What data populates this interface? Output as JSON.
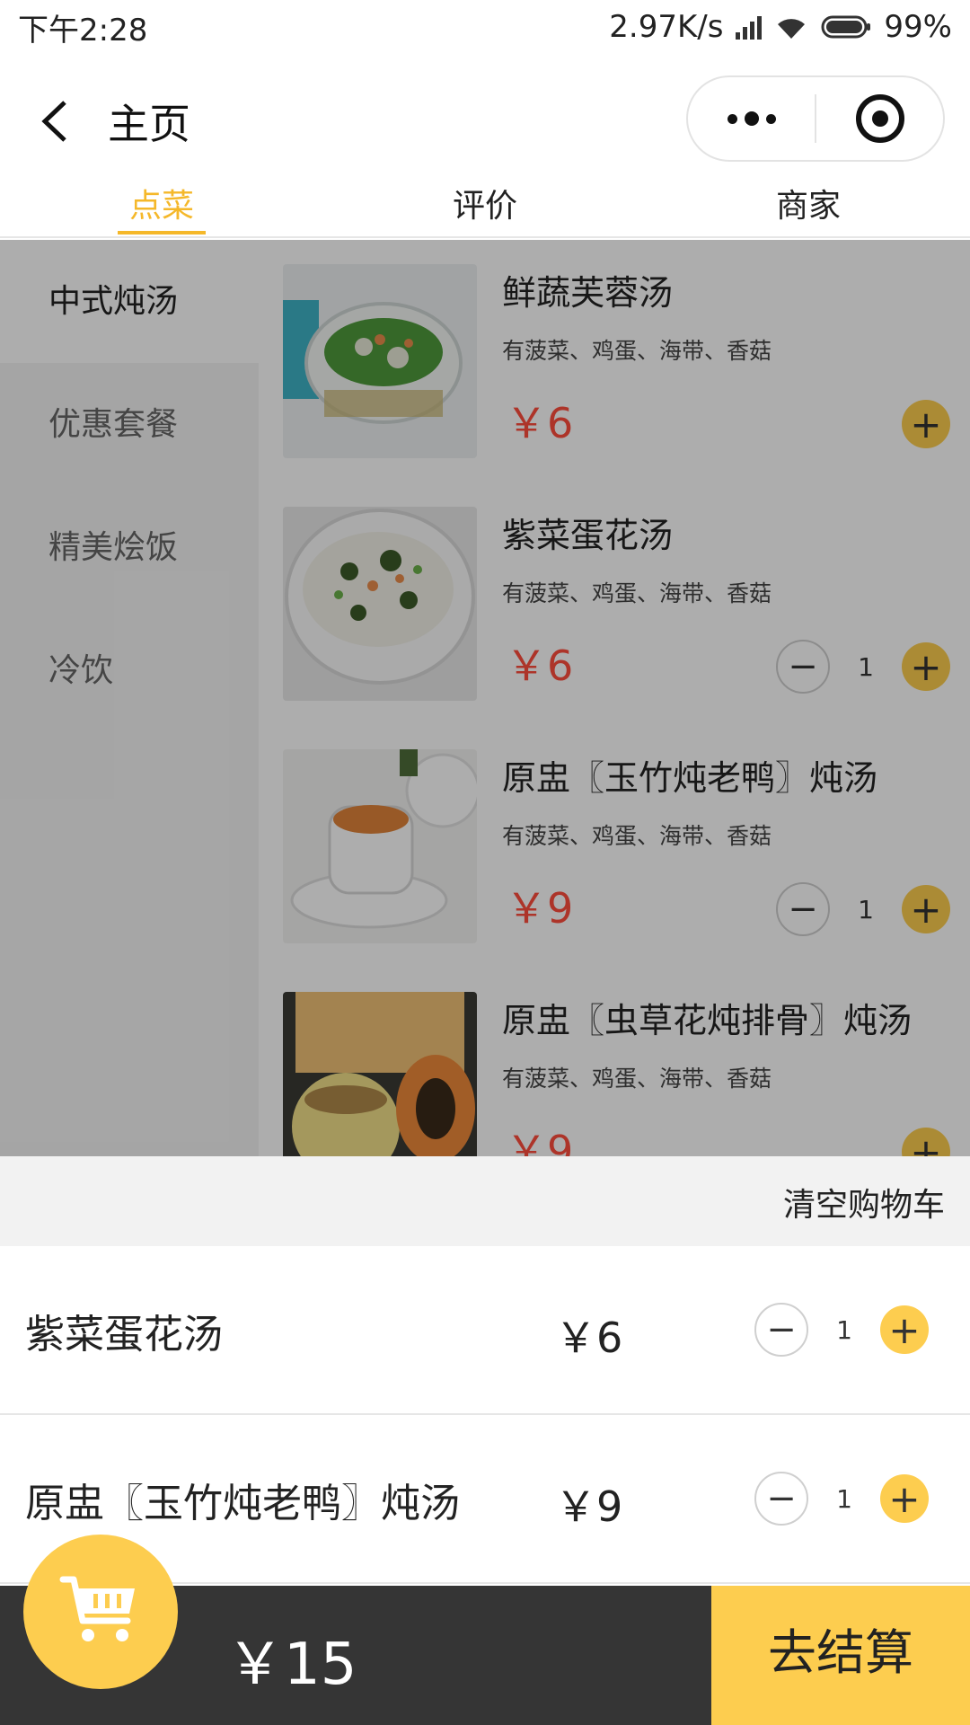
{
  "status_bar": {
    "time": "下午2:28",
    "network_speed": "2.97K/s",
    "battery": "99%"
  },
  "nav": {
    "title": "主页",
    "icons": [
      "back-icon",
      "more-icon",
      "target-icon"
    ]
  },
  "tabs": [
    {
      "label": "点菜",
      "active": true
    },
    {
      "label": "评价",
      "active": false
    },
    {
      "label": "商家",
      "active": false
    }
  ],
  "categories": [
    {
      "label": "中式炖汤",
      "active": true
    },
    {
      "label": "优惠套餐",
      "active": false
    },
    {
      "label": "精美烩饭",
      "active": false
    },
    {
      "label": "冷饮",
      "active": false
    }
  ],
  "dishes": [
    {
      "name": "鲜蔬芙蓉汤",
      "desc": "有菠菜、鸡蛋、海带、香菇",
      "price": "￥6",
      "qty": null
    },
    {
      "name": "紫菜蛋花汤",
      "desc": "有菠菜、鸡蛋、海带、香菇",
      "price": "￥6",
      "qty": "1"
    },
    {
      "name": "原盅〖玉竹炖老鸭〗炖汤",
      "desc": "有菠菜、鸡蛋、海带、香菇",
      "price": "￥9",
      "qty": "1"
    },
    {
      "name": "原盅〖虫草花炖排骨〗炖汤",
      "desc": "有菠菜、鸡蛋、海带、香菇",
      "price": "￥9",
      "qty": null
    }
  ],
  "cart": {
    "clear_label": "清空购物车",
    "items": [
      {
        "name": "紫菜蛋花汤",
        "price": "￥6",
        "qty": "1"
      },
      {
        "name": "原盅〖玉竹炖老鸭〗炖汤",
        "price": "￥9",
        "qty": "1"
      }
    ]
  },
  "footer": {
    "total": "￥15",
    "checkout_label": "去结算"
  },
  "controls": {
    "minus": "−",
    "plus": "+"
  },
  "colors": {
    "accent": "#fdcd4f",
    "tab_active": "#f5b82a",
    "price": "#ff4d3d",
    "bottom_bar": "#353535"
  }
}
